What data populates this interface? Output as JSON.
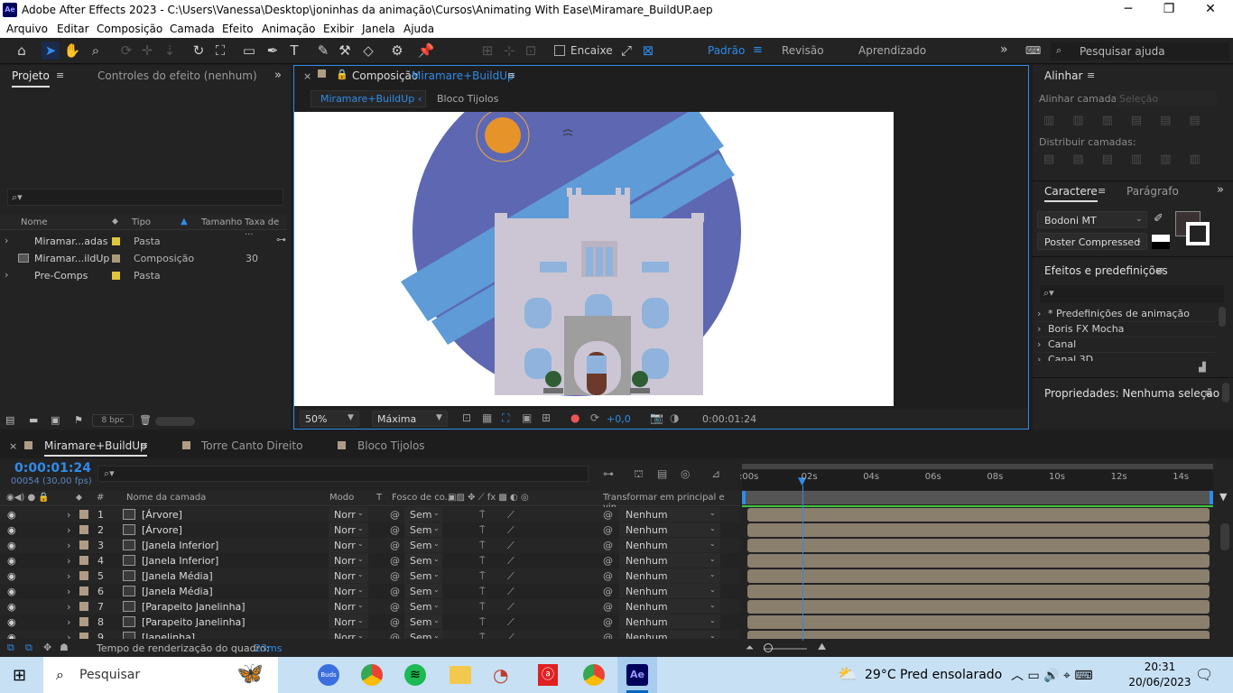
{
  "titlebar": {
    "app_icon": "Ae",
    "title": "Adobe After Effects 2023 - C:\\Users\\Vanessa\\Desktop\\joninhas da animação\\Cursos\\Animating With Ease\\Miramare_BuildUP.aep",
    "minimize": "─",
    "restore": "❐",
    "close": "✕"
  },
  "menu": [
    "Arquivo",
    "Editar",
    "Composição",
    "Camada",
    "Efeito",
    "Animação",
    "Exibir",
    "Janela",
    "Ajuda"
  ],
  "toolbar": {
    "snap_label": "Encaixe",
    "workspaces": [
      "Padrão",
      "Revisão",
      "Aprendizado"
    ],
    "search_placeholder": "Pesquisar ajuda",
    "more": "»"
  },
  "project": {
    "tab_project": "Projeto",
    "tab_effects": "Controles do efeito (nenhum)",
    "search_icon": "⌕▾",
    "columns": {
      "name": "Nome",
      "type": "Tipo",
      "size": "Tamanho",
      "rate": "Taxa de ..."
    },
    "items": [
      {
        "name": "Miramar...adas",
        "type": "Pasta",
        "size": "",
        "color": "#e0c43c",
        "expand": "›"
      },
      {
        "name": "Miramar...ildUp",
        "type": "Composição",
        "size": "30",
        "color": "#a89a78",
        "expand": ""
      },
      {
        "name": "Pre-Comps",
        "type": "Pasta",
        "size": "",
        "color": "#e0c43c",
        "expand": "›"
      }
    ],
    "bpc": "8 bpc"
  },
  "composition": {
    "tab_label": "Composição",
    "comp_name": "Miramare+BuildUp",
    "crumbs": [
      "Miramare+BuildUp",
      "Bloco Tijolos"
    ],
    "zoom": "50%",
    "resolution": "Máxima",
    "exposure": "+0,0",
    "timecode": "0:00:01:24"
  },
  "align": {
    "title": "Alinhar",
    "align_layers": "Alinhar camadas",
    "selection": "Seleção",
    "distribute": "Distribuir camadas:"
  },
  "character": {
    "tab_char": "Caractere",
    "tab_para": "Parágrafo",
    "font": "Bodoni MT",
    "style": "Poster Compressed"
  },
  "effects": {
    "title": "Efeitos e predefinições",
    "items": [
      "* Predefinições de animação",
      "Boris FX Mocha",
      "Canal",
      "Canal 3D"
    ]
  },
  "properties": {
    "title": "Propriedades: Nenhuma seleção"
  },
  "timeline": {
    "tabs": [
      "Miramare+BuildUp",
      "Torre Canto Direito",
      "Bloco Tijolos"
    ],
    "timecode": "0:00:01:24",
    "fps": "00054 (30,00 fps)",
    "columns": {
      "num": "#",
      "name": "Nome da camada",
      "mode": "Modo",
      "t": "T",
      "matte": "Fosco de co...",
      "parent": "Transformar em principal e vin..."
    },
    "ruler": [
      ":00s",
      "02s",
      "04s",
      "06s",
      "08s",
      "10s",
      "12s",
      "14s"
    ],
    "layers": [
      {
        "num": "1",
        "name": "[Árvore]"
      },
      {
        "num": "2",
        "name": "[Árvore]"
      },
      {
        "num": "3",
        "name": "[Janela Inferior]"
      },
      {
        "num": "4",
        "name": "[Janela Inferior]"
      },
      {
        "num": "5",
        "name": "[Janela Média]"
      },
      {
        "num": "6",
        "name": "[Janela Média]"
      },
      {
        "num": "7",
        "name": "[Parapeito Janelinha]"
      },
      {
        "num": "8",
        "name": "[Parapeito Janelinha]"
      },
      {
        "num": "9",
        "name": "[Janelinha]"
      }
    ],
    "mode_value": "Norr",
    "matte_value": "Sem",
    "parent_value": "Nenhum",
    "render_label": "Tempo de renderização do quadro:",
    "render_value": "23ms"
  },
  "taskbar": {
    "search": "Pesquisar",
    "weather": "29°C  Pred ensolarado",
    "time": "20:31",
    "date": "20/06/2023"
  }
}
